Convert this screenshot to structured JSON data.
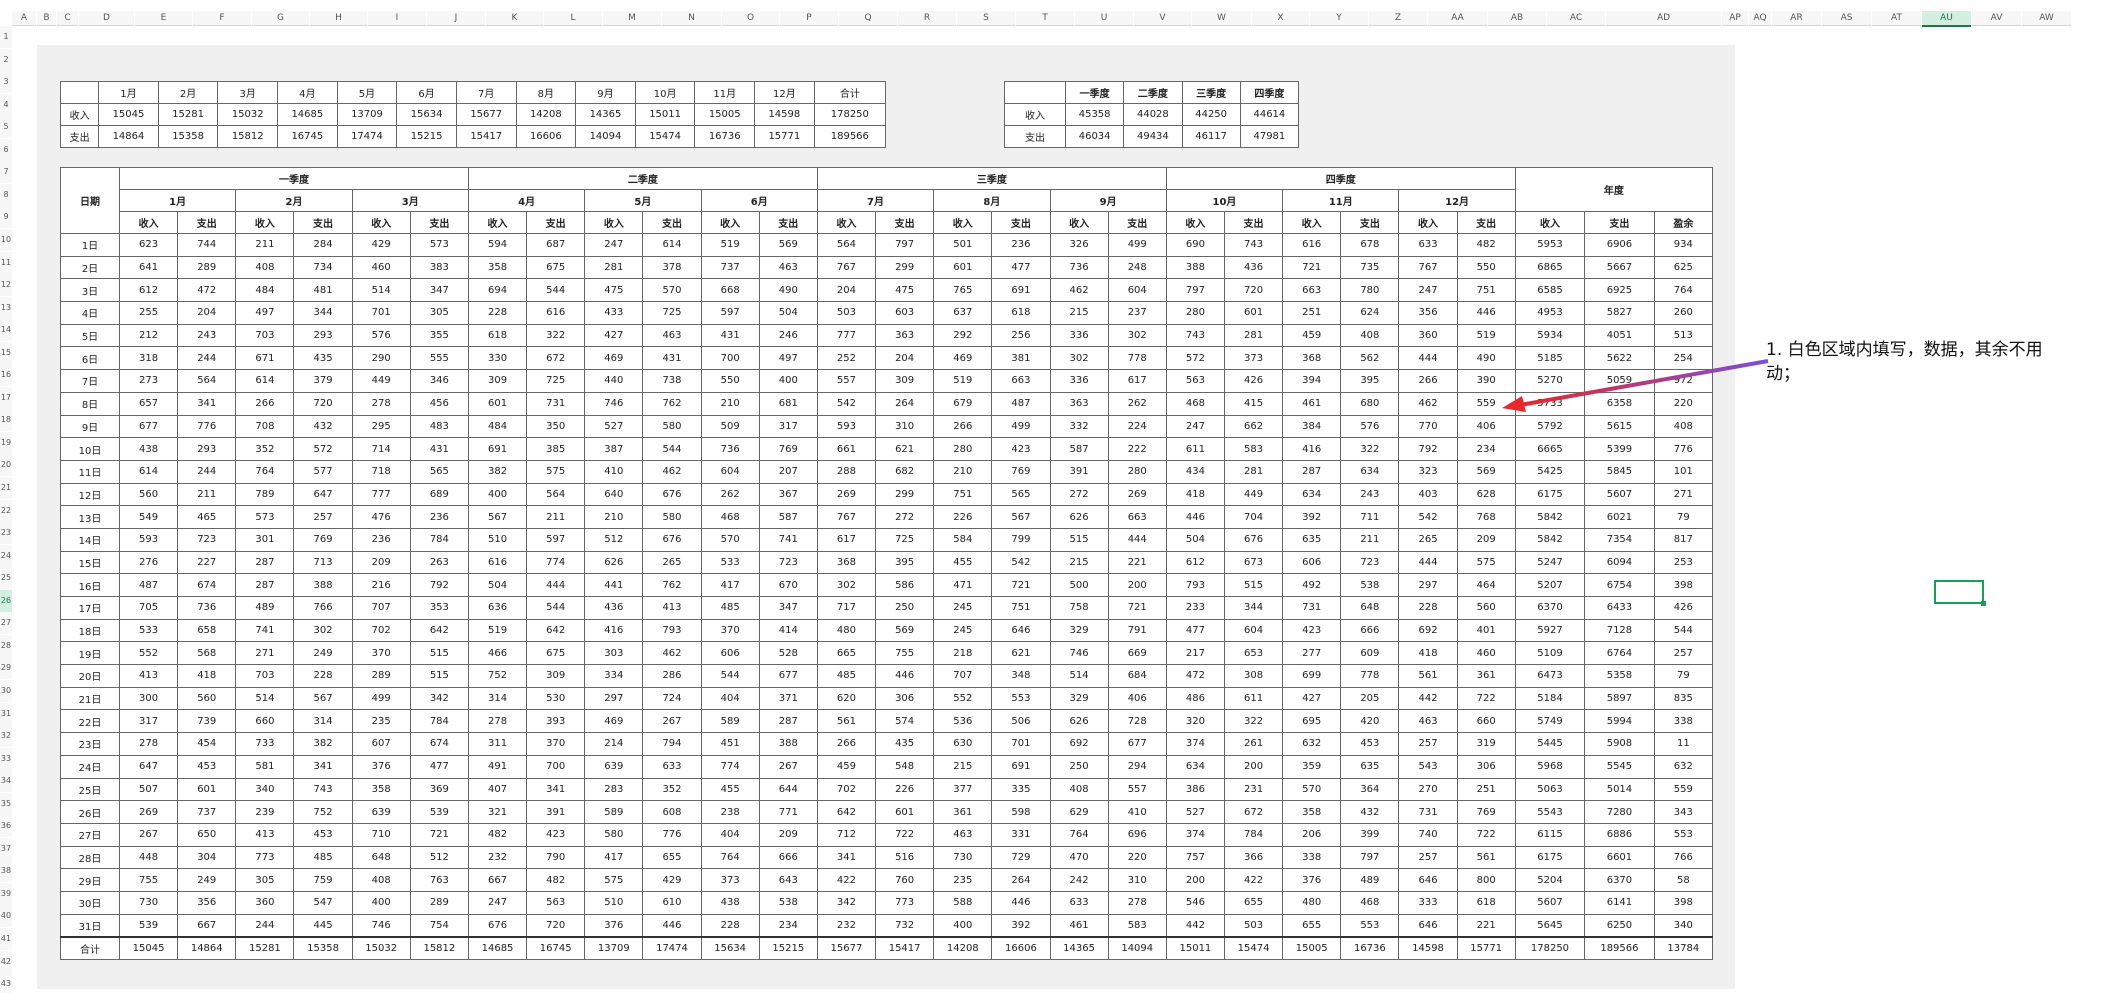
{
  "colors": {
    "accent": "#217346",
    "selection": "#18a058",
    "arrow": "#e8282b"
  },
  "column_headers": [
    "A",
    "B",
    "C",
    "D",
    "E",
    "F",
    "G",
    "H",
    "I",
    "J",
    "K",
    "L",
    "M",
    "N",
    "O",
    "P",
    "Q",
    "R",
    "S",
    "T",
    "U",
    "V",
    "W",
    "X",
    "Y",
    "Z",
    "AA",
    "AB",
    "AC",
    "AD",
    "AP",
    "AQ",
    "AR",
    "AS",
    "AT",
    "AU",
    "AV",
    "AW"
  ],
  "selected_column": "AU",
  "row_headers": [
    "1",
    "2",
    "3",
    "4",
    "5",
    "6",
    "7",
    "8",
    "9",
    "10",
    "11",
    "12",
    "13",
    "14",
    "15",
    "16",
    "17",
    "18",
    "19",
    "20",
    "21",
    "22",
    "23",
    "24",
    "25",
    "26",
    "27",
    "28",
    "29",
    "30",
    "31",
    "32",
    "33",
    "34",
    "35",
    "36",
    "37",
    "38",
    "39",
    "40",
    "41",
    "42",
    "43"
  ],
  "selected_row": "26",
  "summary": {
    "months": [
      "1月",
      "2月",
      "3月",
      "4月",
      "5月",
      "6月",
      "7月",
      "8月",
      "9月",
      "10月",
      "11月",
      "12月"
    ],
    "total_label": "合计",
    "income_label": "收入",
    "expense_label": "支出",
    "income": [
      "15045",
      "15281",
      "15032",
      "14685",
      "13709",
      "15634",
      "15677",
      "14208",
      "14365",
      "15011",
      "15005",
      "14598",
      "178250"
    ],
    "expense": [
      "14864",
      "15358",
      "15812",
      "16745",
      "17474",
      "15215",
      "15417",
      "16606",
      "14094",
      "15474",
      "16736",
      "15771",
      "189566"
    ]
  },
  "quarter_summary": {
    "quarters": [
      "一季度",
      "二季度",
      "三季度",
      "四季度"
    ],
    "income_label": "收入",
    "expense_label": "支出",
    "income": [
      "45358",
      "44028",
      "44250",
      "44614"
    ],
    "expense": [
      "46034",
      "49434",
      "46117",
      "47981"
    ]
  },
  "main": {
    "date_header": "日期",
    "quarter_headers": [
      "一季度",
      "二季度",
      "三季度",
      "四季度"
    ],
    "year_header": "年度",
    "month_headers": [
      "1月",
      "2月",
      "3月",
      "4月",
      "5月",
      "6月",
      "7月",
      "8月",
      "9月",
      "10月",
      "11月",
      "12月"
    ],
    "income_label": "收入",
    "expense_label": "支出",
    "balance_label": "盈余",
    "total_label": "合计",
    "rows": [
      {
        "day": "1日",
        "v": [
          "623",
          "744",
          "211",
          "284",
          "429",
          "573",
          "594",
          "687",
          "247",
          "614",
          "519",
          "569",
          "564",
          "797",
          "501",
          "236",
          "326",
          "499",
          "690",
          "743",
          "616",
          "678",
          "633",
          "482",
          "5953",
          "6906",
          "934"
        ]
      },
      {
        "day": "2日",
        "v": [
          "641",
          "289",
          "408",
          "734",
          "460",
          "383",
          "358",
          "675",
          "281",
          "378",
          "737",
          "463",
          "767",
          "299",
          "601",
          "477",
          "736",
          "248",
          "388",
          "436",
          "721",
          "735",
          "767",
          "550",
          "6865",
          "5667",
          "625"
        ]
      },
      {
        "day": "3日",
        "v": [
          "612",
          "472",
          "484",
          "481",
          "514",
          "347",
          "694",
          "544",
          "475",
          "570",
          "668",
          "490",
          "204",
          "475",
          "765",
          "691",
          "462",
          "604",
          "797",
          "720",
          "663",
          "780",
          "247",
          "751",
          "6585",
          "6925",
          "764"
        ]
      },
      {
        "day": "4日",
        "v": [
          "255",
          "204",
          "497",
          "344",
          "701",
          "305",
          "228",
          "616",
          "433",
          "725",
          "597",
          "504",
          "503",
          "603",
          "637",
          "618",
          "215",
          "237",
          "280",
          "601",
          "251",
          "624",
          "356",
          "446",
          "4953",
          "5827",
          "260"
        ]
      },
      {
        "day": "5日",
        "v": [
          "212",
          "243",
          "703",
          "293",
          "576",
          "355",
          "618",
          "322",
          "427",
          "463",
          "431",
          "246",
          "777",
          "363",
          "292",
          "256",
          "336",
          "302",
          "743",
          "281",
          "459",
          "408",
          "360",
          "519",
          "5934",
          "4051",
          "513"
        ]
      },
      {
        "day": "6日",
        "v": [
          "318",
          "244",
          "671",
          "435",
          "290",
          "555",
          "330",
          "672",
          "469",
          "431",
          "700",
          "497",
          "252",
          "204",
          "469",
          "381",
          "302",
          "778",
          "572",
          "373",
          "368",
          "562",
          "444",
          "490",
          "5185",
          "5622",
          "254"
        ]
      },
      {
        "day": "7日",
        "v": [
          "273",
          "564",
          "614",
          "379",
          "449",
          "346",
          "309",
          "725",
          "440",
          "738",
          "550",
          "400",
          "557",
          "309",
          "519",
          "663",
          "336",
          "617",
          "563",
          "426",
          "394",
          "395",
          "266",
          "390",
          "5270",
          "5059",
          "972"
        ]
      },
      {
        "day": "8日",
        "v": [
          "657",
          "341",
          "266",
          "720",
          "278",
          "456",
          "601",
          "731",
          "746",
          "762",
          "210",
          "681",
          "542",
          "264",
          "679",
          "487",
          "363",
          "262",
          "468",
          "415",
          "461",
          "680",
          "462",
          "559",
          "5733",
          "6358",
          "220"
        ]
      },
      {
        "day": "9日",
        "v": [
          "677",
          "776",
          "708",
          "432",
          "295",
          "483",
          "484",
          "350",
          "527",
          "580",
          "509",
          "317",
          "593",
          "310",
          "266",
          "499",
          "332",
          "224",
          "247",
          "662",
          "384",
          "576",
          "770",
          "406",
          "5792",
          "5615",
          "408"
        ]
      },
      {
        "day": "10日",
        "v": [
          "438",
          "293",
          "352",
          "572",
          "714",
          "431",
          "691",
          "385",
          "387",
          "544",
          "736",
          "769",
          "661",
          "621",
          "280",
          "423",
          "587",
          "222",
          "611",
          "583",
          "416",
          "322",
          "792",
          "234",
          "6665",
          "5399",
          "776"
        ]
      },
      {
        "day": "11日",
        "v": [
          "614",
          "244",
          "764",
          "577",
          "718",
          "565",
          "382",
          "575",
          "410",
          "462",
          "604",
          "207",
          "288",
          "682",
          "210",
          "769",
          "391",
          "280",
          "434",
          "281",
          "287",
          "634",
          "323",
          "569",
          "5425",
          "5845",
          "101"
        ]
      },
      {
        "day": "12日",
        "v": [
          "560",
          "211",
          "789",
          "647",
          "777",
          "689",
          "400",
          "564",
          "640",
          "676",
          "262",
          "367",
          "269",
          "299",
          "751",
          "565",
          "272",
          "269",
          "418",
          "449",
          "634",
          "243",
          "403",
          "628",
          "6175",
          "5607",
          "271"
        ]
      },
      {
        "day": "13日",
        "v": [
          "549",
          "465",
          "573",
          "257",
          "476",
          "236",
          "567",
          "211",
          "210",
          "580",
          "468",
          "587",
          "767",
          "272",
          "226",
          "567",
          "626",
          "663",
          "446",
          "704",
          "392",
          "711",
          "542",
          "768",
          "5842",
          "6021",
          "79"
        ]
      },
      {
        "day": "14日",
        "v": [
          "593",
          "723",
          "301",
          "769",
          "236",
          "784",
          "510",
          "597",
          "512",
          "676",
          "570",
          "741",
          "617",
          "725",
          "584",
          "799",
          "515",
          "444",
          "504",
          "676",
          "635",
          "211",
          "265",
          "209",
          "5842",
          "7354",
          "817"
        ]
      },
      {
        "day": "15日",
        "v": [
          "276",
          "227",
          "287",
          "713",
          "209",
          "263",
          "616",
          "774",
          "626",
          "265",
          "533",
          "723",
          "368",
          "395",
          "455",
          "542",
          "215",
          "221",
          "612",
          "673",
          "606",
          "723",
          "444",
          "575",
          "5247",
          "6094",
          "253"
        ]
      },
      {
        "day": "16日",
        "v": [
          "487",
          "674",
          "287",
          "388",
          "216",
          "792",
          "504",
          "444",
          "441",
          "762",
          "417",
          "670",
          "302",
          "586",
          "471",
          "721",
          "500",
          "200",
          "793",
          "515",
          "492",
          "538",
          "297",
          "464",
          "5207",
          "6754",
          "398"
        ]
      },
      {
        "day": "17日",
        "v": [
          "705",
          "736",
          "489",
          "766",
          "707",
          "353",
          "636",
          "544",
          "436",
          "413",
          "485",
          "347",
          "717",
          "250",
          "245",
          "751",
          "758",
          "721",
          "233",
          "344",
          "731",
          "648",
          "228",
          "560",
          "6370",
          "6433",
          "426"
        ]
      },
      {
        "day": "18日",
        "v": [
          "533",
          "658",
          "741",
          "302",
          "702",
          "642",
          "519",
          "642",
          "416",
          "793",
          "370",
          "414",
          "480",
          "569",
          "245",
          "646",
          "329",
          "791",
          "477",
          "604",
          "423",
          "666",
          "692",
          "401",
          "5927",
          "7128",
          "544"
        ]
      },
      {
        "day": "19日",
        "v": [
          "552",
          "568",
          "271",
          "249",
          "370",
          "515",
          "466",
          "675",
          "303",
          "462",
          "606",
          "528",
          "665",
          "755",
          "218",
          "621",
          "746",
          "669",
          "217",
          "653",
          "277",
          "609",
          "418",
          "460",
          "5109",
          "6764",
          "257"
        ]
      },
      {
        "day": "20日",
        "v": [
          "413",
          "418",
          "703",
          "228",
          "289",
          "515",
          "752",
          "309",
          "334",
          "286",
          "544",
          "677",
          "485",
          "446",
          "707",
          "348",
          "514",
          "684",
          "472",
          "308",
          "699",
          "778",
          "561",
          "361",
          "6473",
          "5358",
          "79"
        ]
      },
      {
        "day": "21日",
        "v": [
          "300",
          "560",
          "514",
          "567",
          "499",
          "342",
          "314",
          "530",
          "297",
          "724",
          "404",
          "371",
          "620",
          "306",
          "552",
          "553",
          "329",
          "406",
          "486",
          "611",
          "427",
          "205",
          "442",
          "722",
          "5184",
          "5897",
          "835"
        ]
      },
      {
        "day": "22日",
        "v": [
          "317",
          "739",
          "660",
          "314",
          "235",
          "784",
          "278",
          "393",
          "469",
          "267",
          "589",
          "287",
          "561",
          "574",
          "536",
          "506",
          "626",
          "728",
          "320",
          "322",
          "695",
          "420",
          "463",
          "660",
          "5749",
          "5994",
          "338"
        ]
      },
      {
        "day": "23日",
        "v": [
          "278",
          "454",
          "733",
          "382",
          "607",
          "674",
          "311",
          "370",
          "214",
          "794",
          "451",
          "388",
          "266",
          "435",
          "630",
          "701",
          "692",
          "677",
          "374",
          "261",
          "632",
          "453",
          "257",
          "319",
          "5445",
          "5908",
          "11"
        ]
      },
      {
        "day": "24日",
        "v": [
          "647",
          "453",
          "581",
          "341",
          "376",
          "477",
          "491",
          "700",
          "639",
          "633",
          "774",
          "267",
          "459",
          "548",
          "215",
          "691",
          "250",
          "294",
          "634",
          "200",
          "359",
          "635",
          "543",
          "306",
          "5968",
          "5545",
          "632"
        ]
      },
      {
        "day": "25日",
        "v": [
          "507",
          "601",
          "340",
          "743",
          "358",
          "369",
          "407",
          "341",
          "283",
          "352",
          "455",
          "644",
          "702",
          "226",
          "377",
          "335",
          "408",
          "557",
          "386",
          "231",
          "570",
          "364",
          "270",
          "251",
          "5063",
          "5014",
          "559"
        ]
      },
      {
        "day": "26日",
        "v": [
          "269",
          "737",
          "239",
          "752",
          "639",
          "539",
          "321",
          "391",
          "589",
          "608",
          "238",
          "771",
          "642",
          "601",
          "361",
          "598",
          "629",
          "410",
          "527",
          "672",
          "358",
          "432",
          "731",
          "769",
          "5543",
          "7280",
          "343"
        ]
      },
      {
        "day": "27日",
        "v": [
          "267",
          "650",
          "413",
          "453",
          "710",
          "721",
          "482",
          "423",
          "580",
          "776",
          "404",
          "209",
          "712",
          "722",
          "463",
          "331",
          "764",
          "696",
          "374",
          "784",
          "206",
          "399",
          "740",
          "722",
          "6115",
          "6886",
          "553"
        ]
      },
      {
        "day": "28日",
        "v": [
          "448",
          "304",
          "773",
          "485",
          "648",
          "512",
          "232",
          "790",
          "417",
          "655",
          "764",
          "666",
          "341",
          "516",
          "730",
          "729",
          "470",
          "220",
          "757",
          "366",
          "338",
          "797",
          "257",
          "561",
          "6175",
          "6601",
          "766"
        ]
      },
      {
        "day": "29日",
        "v": [
          "755",
          "249",
          "305",
          "759",
          "408",
          "763",
          "667",
          "482",
          "575",
          "429",
          "373",
          "643",
          "422",
          "760",
          "235",
          "264",
          "242",
          "310",
          "200",
          "422",
          "376",
          "489",
          "646",
          "800",
          "5204",
          "6370",
          "58"
        ]
      },
      {
        "day": "30日",
        "v": [
          "730",
          "356",
          "360",
          "547",
          "400",
          "289",
          "247",
          "563",
          "510",
          "610",
          "438",
          "538",
          "342",
          "773",
          "588",
          "446",
          "633",
          "278",
          "546",
          "655",
          "480",
          "468",
          "333",
          "618",
          "5607",
          "6141",
          "398"
        ]
      },
      {
        "day": "31日",
        "v": [
          "539",
          "667",
          "244",
          "445",
          "746",
          "754",
          "676",
          "720",
          "376",
          "446",
          "228",
          "234",
          "232",
          "732",
          "400",
          "392",
          "461",
          "583",
          "442",
          "503",
          "655",
          "553",
          "646",
          "221",
          "5645",
          "6250",
          "340"
        ]
      }
    ],
    "totals": [
      "15045",
      "14864",
      "15281",
      "15358",
      "15032",
      "15812",
      "14685",
      "16745",
      "13709",
      "17474",
      "15634",
      "15215",
      "15677",
      "15417",
      "14208",
      "16606",
      "14365",
      "14094",
      "15011",
      "15474",
      "15005",
      "16736",
      "14598",
      "15771",
      "178250",
      "189566",
      "13784"
    ]
  },
  "annotation": {
    "text": "1. 白色区域内填写，数据，其余不用动；"
  }
}
